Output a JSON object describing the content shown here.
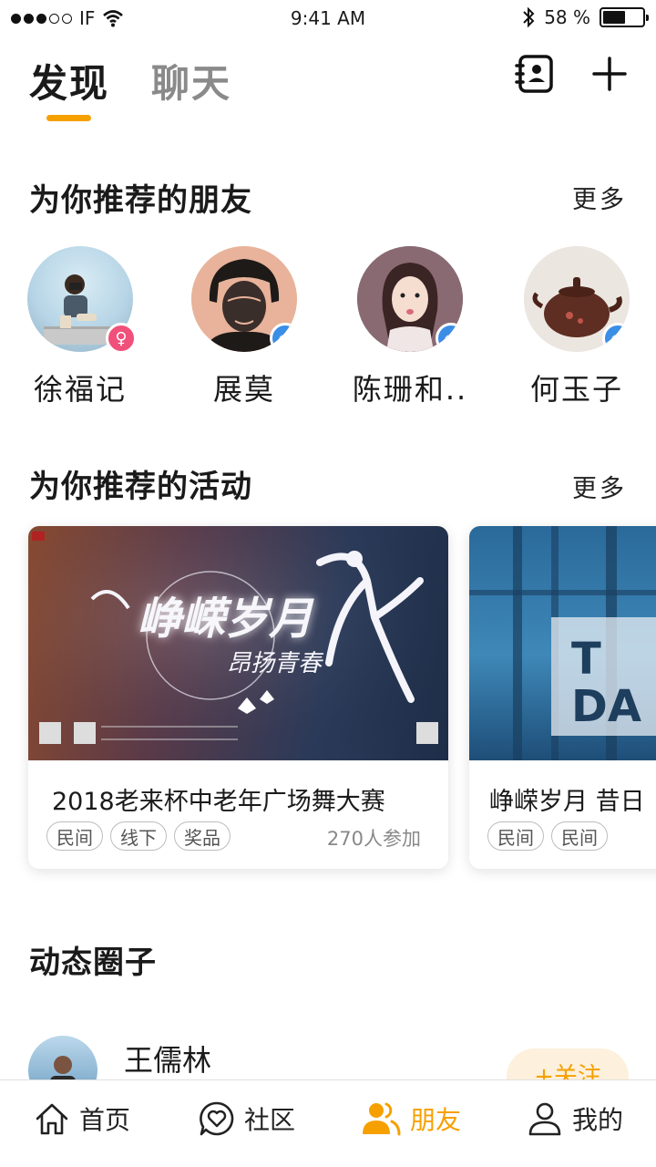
{
  "status_bar": {
    "carrier": "IF",
    "time": "9:41 AM",
    "battery": "58 %",
    "battery_level": 0.58
  },
  "header": {
    "tabs": [
      {
        "label": "发现",
        "active": true
      },
      {
        "label": "聊天",
        "active": false
      }
    ],
    "icons": [
      "contacts-book-icon",
      "plus-icon"
    ],
    "accent_color": "#f6a000"
  },
  "friends_section": {
    "title": "为你推荐的朋友",
    "more": "更多",
    "friends": [
      {
        "name": "徐福记",
        "gender": "female"
      },
      {
        "name": "展莫",
        "gender": "male"
      },
      {
        "name": "陈珊和..",
        "gender": "male"
      },
      {
        "name": "何玉子",
        "gender": "male"
      }
    ]
  },
  "events_section": {
    "title": "为你推荐的活动",
    "more": "更多",
    "events": [
      {
        "title": "2018老来杯中老年广场舞大赛",
        "tags": [
          "民间",
          "线下",
          "奖品"
        ],
        "participants": "270人参加",
        "banner_text": "峥嵘岁月",
        "banner_subtext": "昂扬青春"
      },
      {
        "title": "峥嵘岁月 昔日",
        "tags": [
          "民间",
          "民间"
        ],
        "participants": "",
        "banner_text": "T DA"
      }
    ]
  },
  "feed_section": {
    "title": "动态圈子",
    "posts": [
      {
        "user": "王儒林",
        "follow_label": "+关注"
      }
    ]
  },
  "bottom_nav": {
    "items": [
      {
        "label": "首页",
        "icon": "home-icon"
      },
      {
        "label": "社区",
        "icon": "heart-chat-icon"
      },
      {
        "label": "朋友",
        "icon": "friends-icon",
        "active": true
      },
      {
        "label": "我的",
        "icon": "user-icon"
      }
    ]
  }
}
